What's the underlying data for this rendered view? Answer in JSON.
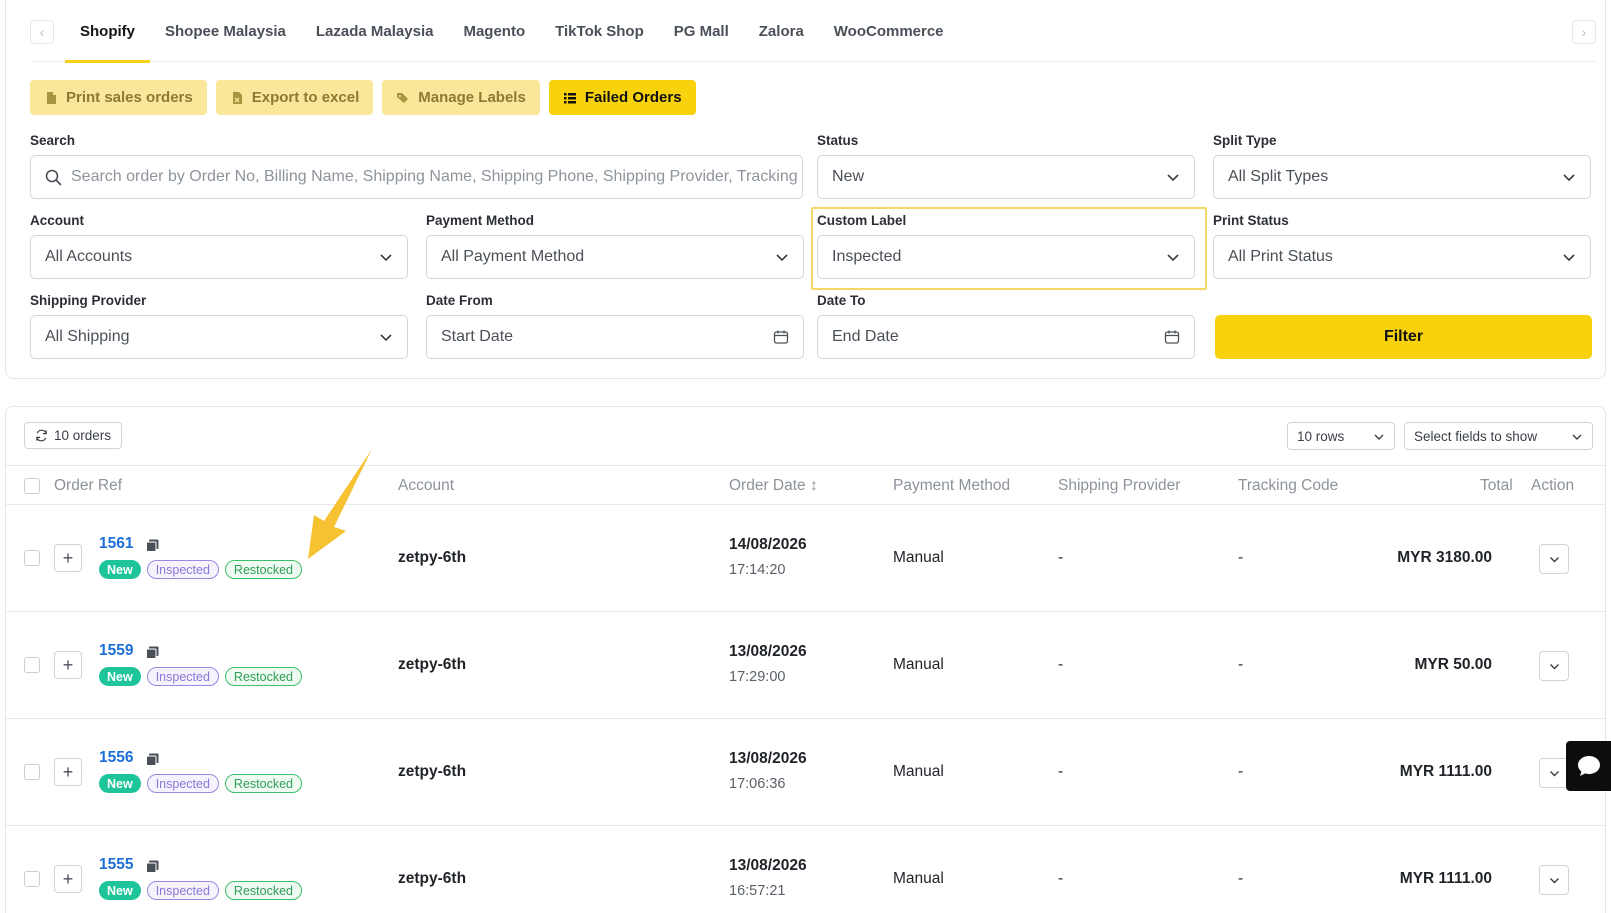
{
  "tabs": {
    "items": [
      {
        "label": "Shopify",
        "active": true
      },
      {
        "label": "Shopee Malaysia",
        "active": false
      },
      {
        "label": "Lazada Malaysia",
        "active": false
      },
      {
        "label": "Magento",
        "active": false
      },
      {
        "label": "TikTok Shop",
        "active": false
      },
      {
        "label": "PG Mall",
        "active": false
      },
      {
        "label": "Zalora",
        "active": false
      },
      {
        "label": "WooCommerce",
        "active": false
      }
    ]
  },
  "actions": {
    "print_sales_orders": "Print sales orders",
    "export_to_excel": "Export to excel",
    "manage_labels": "Manage Labels",
    "failed_orders": "Failed Orders"
  },
  "filters": {
    "search": {
      "label": "Search",
      "placeholder": "Search order by Order No, Billing Name, Shipping Name, Shipping Phone, Shipping Provider, Tracking"
    },
    "status": {
      "label": "Status",
      "value": "New"
    },
    "split_type": {
      "label": "Split Type",
      "value": "All Split Types"
    },
    "account": {
      "label": "Account",
      "value": "All Accounts"
    },
    "payment_method": {
      "label": "Payment Method",
      "value": "All Payment Method"
    },
    "custom_label": {
      "label": "Custom Label",
      "value": "Inspected"
    },
    "print_status": {
      "label": "Print Status",
      "value": "All Print Status"
    },
    "shipping_provider": {
      "label": "Shipping Provider",
      "value": "All Shipping"
    },
    "date_from": {
      "label": "Date From",
      "placeholder": "Start Date"
    },
    "date_to": {
      "label": "Date To",
      "placeholder": "End Date"
    },
    "filter_button": "Filter"
  },
  "orders": {
    "count_label": "10 orders",
    "rows_select": "10 rows",
    "fields_select": "Select fields to show",
    "columns": {
      "order_ref": "Order Ref",
      "account": "Account",
      "order_date": "Order Date ↕",
      "payment_method": "Payment Method",
      "shipping_provider": "Shipping Provider",
      "tracking_code": "Tracking Code",
      "total": "Total",
      "action": "Action"
    },
    "rows": [
      {
        "order_no": "1561",
        "badges": [
          "New",
          "Inspected",
          "Restocked"
        ],
        "account": "zetpy-6th",
        "date": "14/08/2026",
        "time": "17:14:20",
        "payment": "Manual",
        "shipping": "-",
        "tracking": "-",
        "total": "MYR 3180.00"
      },
      {
        "order_no": "1559",
        "badges": [
          "New",
          "Inspected",
          "Restocked"
        ],
        "account": "zetpy-6th",
        "date": "13/08/2026",
        "time": "17:29:00",
        "payment": "Manual",
        "shipping": "-",
        "tracking": "-",
        "total": "MYR 50.00"
      },
      {
        "order_no": "1556",
        "badges": [
          "New",
          "Inspected",
          "Restocked"
        ],
        "account": "zetpy-6th",
        "date": "13/08/2026",
        "time": "17:06:36",
        "payment": "Manual",
        "shipping": "-",
        "tracking": "-",
        "total": "MYR 1111.00"
      },
      {
        "order_no": "1555",
        "badges": [
          "New",
          "Inspected",
          "Restocked"
        ],
        "account": "zetpy-6th",
        "date": "13/08/2026",
        "time": "16:57:21",
        "payment": "Manual",
        "shipping": "-",
        "tracking": "-",
        "total": "MYR 1111.00"
      }
    ]
  },
  "colors": {
    "accent_yellow": "#f8d20d",
    "link_blue": "#1d6fd8",
    "badge_new": "#1ec59a",
    "badge_inspected": "#8a77d6",
    "badge_restocked": "#2f9e57",
    "annotation_arrow": "#f6c232"
  },
  "icons": {
    "chat": "chat-bubble-icon",
    "search": "search-icon",
    "calendar": "calendar-icon",
    "copy": "copy-icon"
  }
}
